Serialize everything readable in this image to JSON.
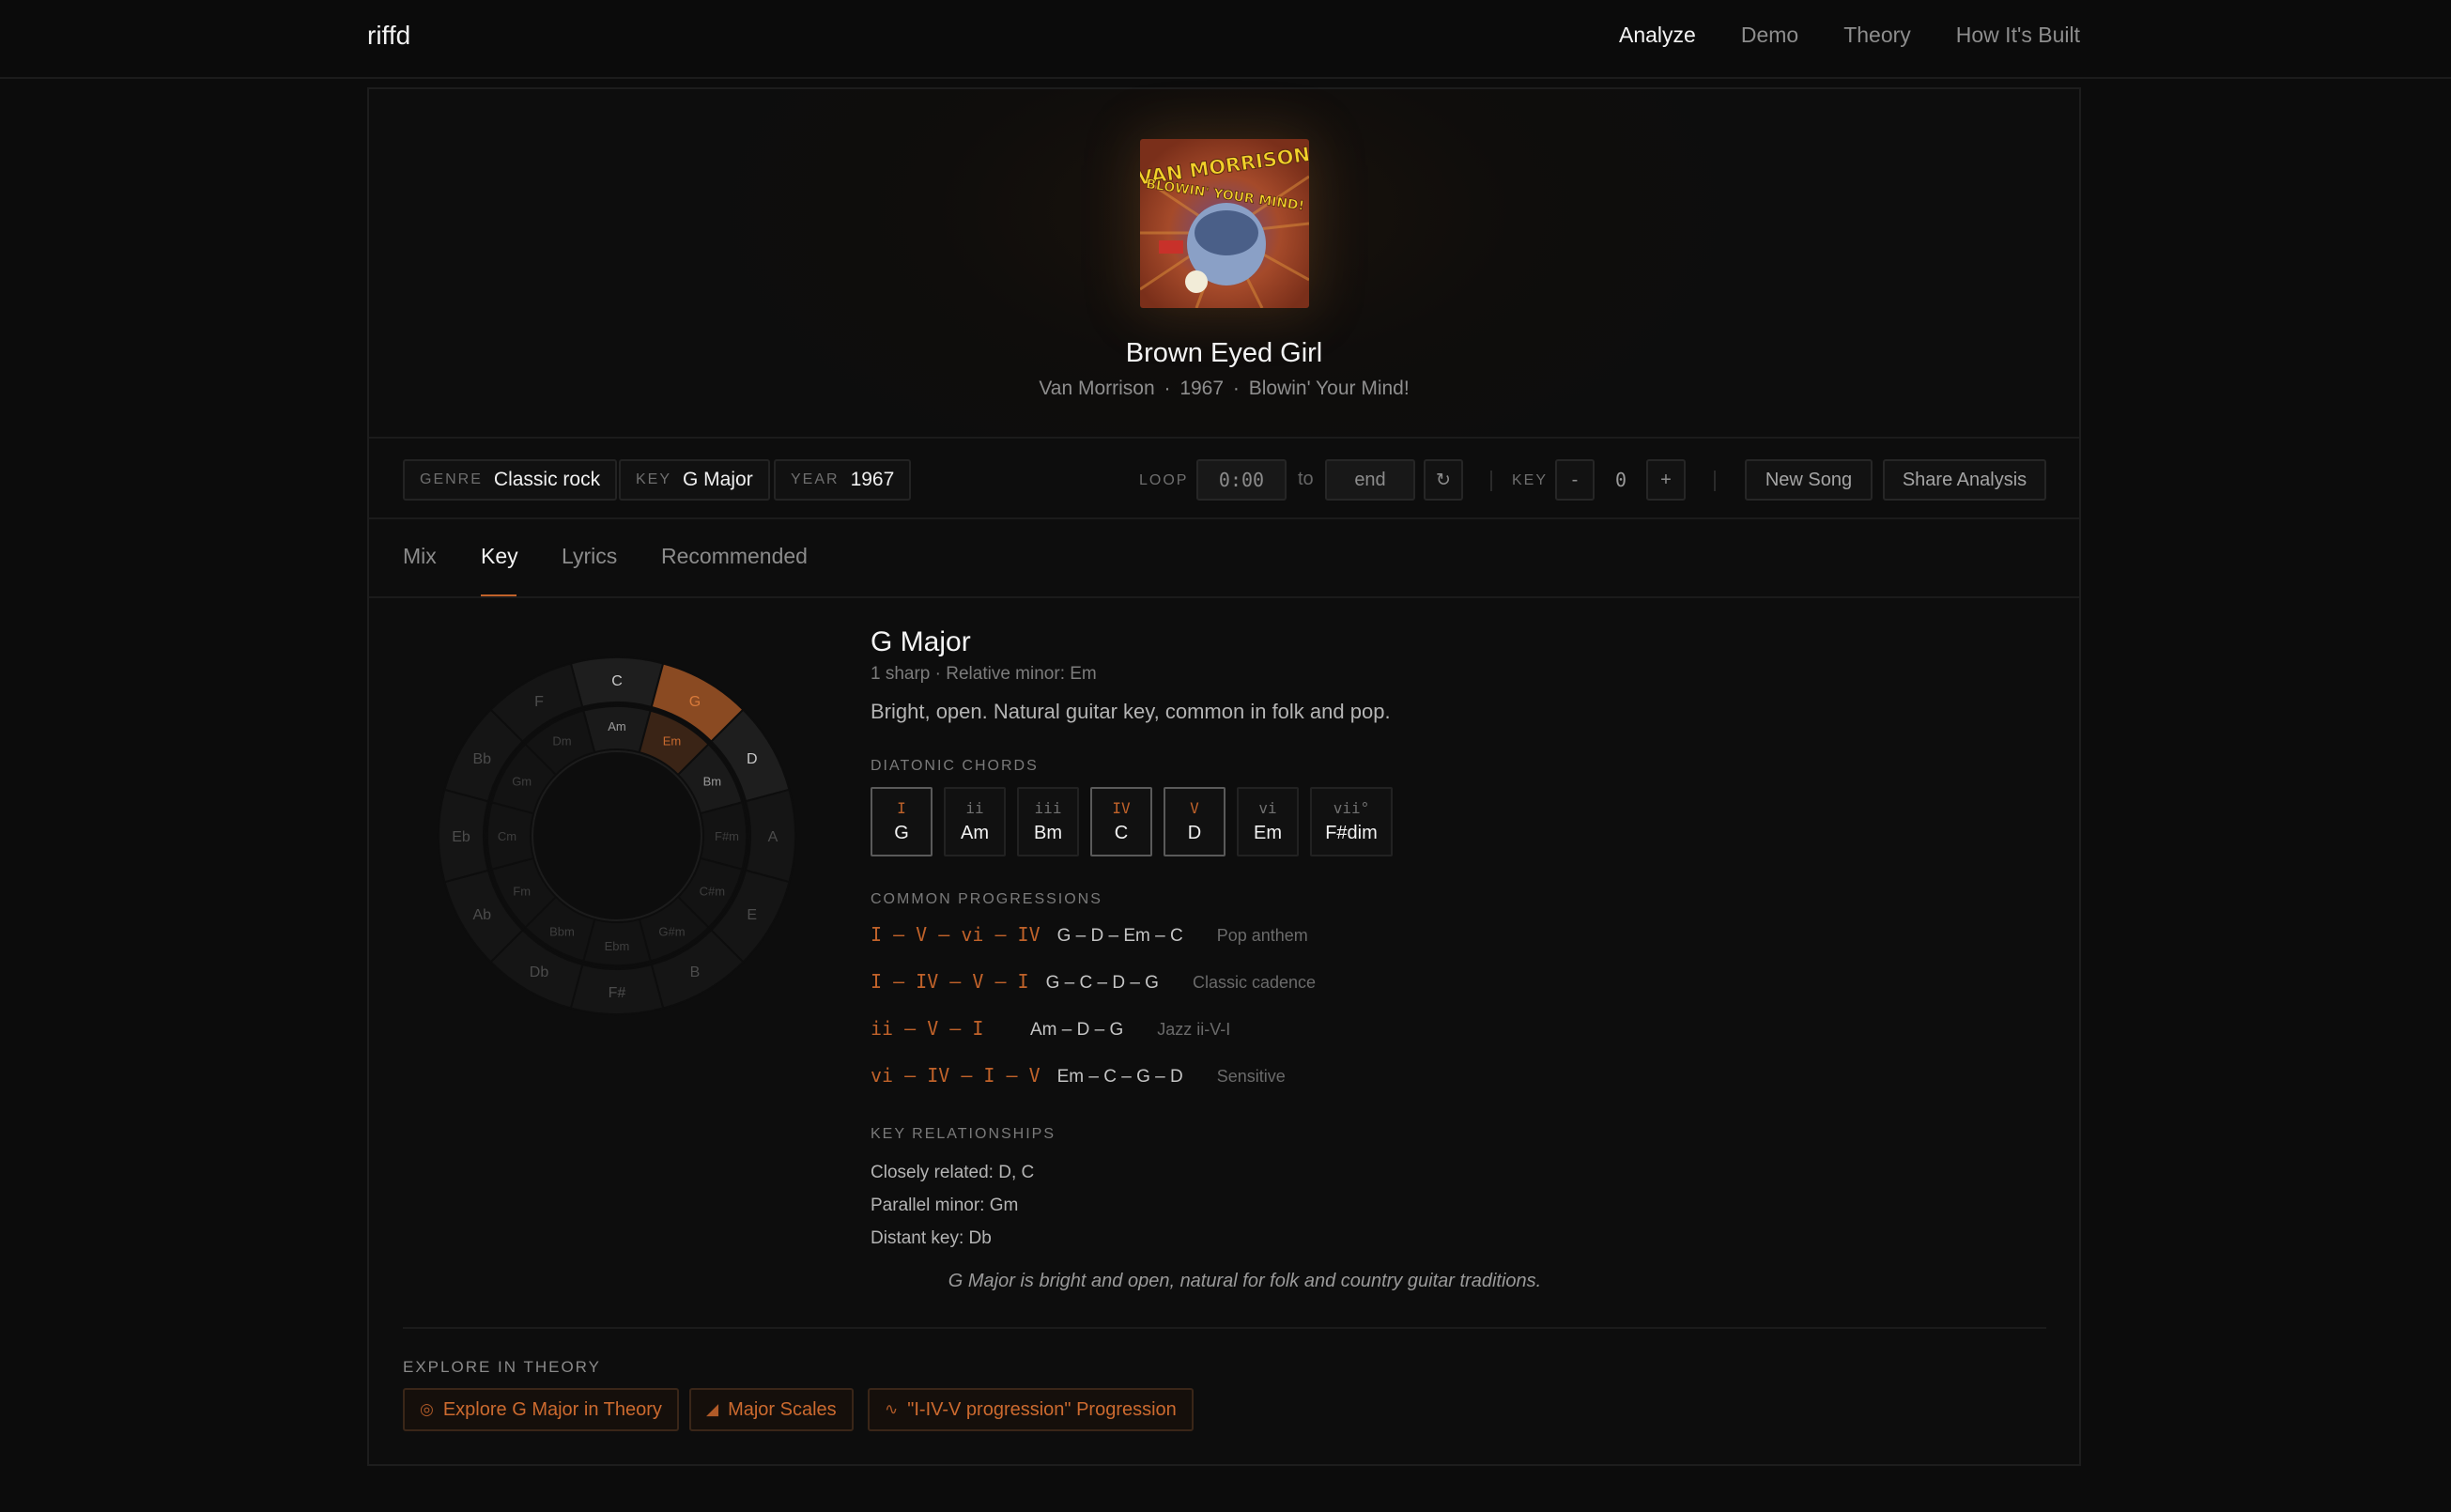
{
  "nav": {
    "brand": "riffd",
    "links": [
      "Analyze",
      "Demo",
      "Theory",
      "How It's Built"
    ]
  },
  "song": {
    "title": "Brown Eyed Girl",
    "artist": "Van Morrison",
    "year": "1967",
    "album": "Blowin' Your Mind!",
    "separator": "·",
    "cover_text_top": "VAN MORRISON",
    "cover_text_bottom": "BLOWIN' YOUR MIND!"
  },
  "meta": {
    "genre_label": "GENRE",
    "genre": "Classic rock",
    "key_label": "KEY",
    "key": "G Major",
    "year_label": "YEAR",
    "year": "1967",
    "loop_label": "LOOP",
    "loop_start": "0:00",
    "loop_to": "to",
    "loop_end": "end",
    "transpose_label": "KEY",
    "transpose_minus": "-",
    "transpose_value": "0",
    "transpose_plus": "+",
    "new_song": "New Song",
    "share": "Share Analysis"
  },
  "tabs": [
    "Mix",
    "Key",
    "Lyrics",
    "Recommended"
  ],
  "active_tab": "Key",
  "wheel": {
    "major": [
      "C",
      "G",
      "D",
      "A",
      "E",
      "B",
      "F#",
      "Db",
      "Ab",
      "Eb",
      "Bb",
      "F"
    ],
    "minor": [
      "Am",
      "Em",
      "Bm",
      "F#m",
      "C#m",
      "G#m",
      "Ebm",
      "Bbm",
      "Fm",
      "Cm",
      "Gm",
      "Dm"
    ],
    "active_major": "G",
    "active_minor": "Em",
    "accent": "#c0622a"
  },
  "key_info": {
    "title": "G Major",
    "subtitle": "1 sharp · Relative minor: Em",
    "description": "Bright, open. Natural guitar key, common in folk and pop."
  },
  "diatonic": {
    "label": "DIATONIC CHORDS",
    "chords": [
      {
        "roman": "I",
        "name": "G",
        "highlight": true
      },
      {
        "roman": "ii",
        "name": "Am",
        "highlight": false
      },
      {
        "roman": "iii",
        "name": "Bm",
        "highlight": false
      },
      {
        "roman": "IV",
        "name": "C",
        "highlight": true
      },
      {
        "roman": "V",
        "name": "D",
        "highlight": true
      },
      {
        "roman": "vi",
        "name": "Em",
        "highlight": false
      },
      {
        "roman": "vii°",
        "name": "F#dim",
        "highlight": false
      }
    ]
  },
  "progressions": {
    "label": "COMMON PROGRESSIONS",
    "items": [
      {
        "roman": "I – V – vi – IV",
        "names": "G – D – Em – C",
        "tag": "Pop anthem"
      },
      {
        "roman": "I – IV – V – I",
        "names": "G – C – D – G",
        "tag": "Classic cadence"
      },
      {
        "roman": "ii – V – I",
        "names": "Am – D – G",
        "tag": "Jazz ii-V-I"
      },
      {
        "roman": "vi – IV – I – V",
        "names": "Em – C – G – D",
        "tag": "Sensitive"
      }
    ]
  },
  "relationships": {
    "label": "KEY RELATIONSHIPS",
    "closely": "Closely related: D, C",
    "parallel": "Parallel minor: Gm",
    "distant": "Distant key: Db"
  },
  "quote": "G Major is bright and open, natural for folk and country guitar traditions.",
  "explore": {
    "label": "EXPLORE IN THEORY",
    "buttons": [
      {
        "icon": "compass-icon",
        "label": "Explore G Major in Theory"
      },
      {
        "icon": "scale-icon",
        "label": "Major Scales"
      },
      {
        "icon": "wave-icon",
        "label": "\"I-IV-V progression\" Progression"
      }
    ]
  }
}
